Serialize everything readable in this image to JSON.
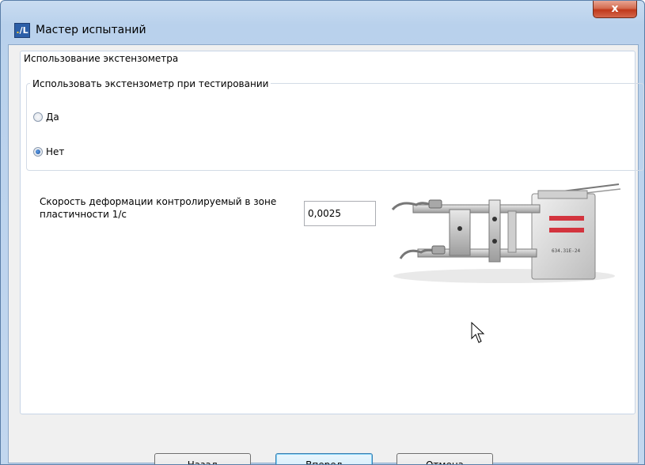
{
  "window": {
    "title": "Мастер испытаний",
    "icon": "app-logo-icon",
    "close_label": "x"
  },
  "section": {
    "title": "Использование экстензометра"
  },
  "extensometer_group": {
    "title": "Использовать экстензометр при тестировании",
    "options": [
      {
        "label": "Да",
        "checked": false
      },
      {
        "label": "Нет",
        "checked": true
      }
    ]
  },
  "strain_rate": {
    "label": "Скорость деформации контролируемый в зоне пластичности 1/с",
    "value": "0,0025"
  },
  "image": {
    "engraving": "634.31E-24"
  },
  "footer": {
    "back_label": "Назад",
    "next_label": "Вперед",
    "cancel_label": "Отмена"
  },
  "colors": {
    "titlebar": "#b9d1ec",
    "close_button": "#c0391b",
    "default_button_border": "#3c7fb1"
  }
}
